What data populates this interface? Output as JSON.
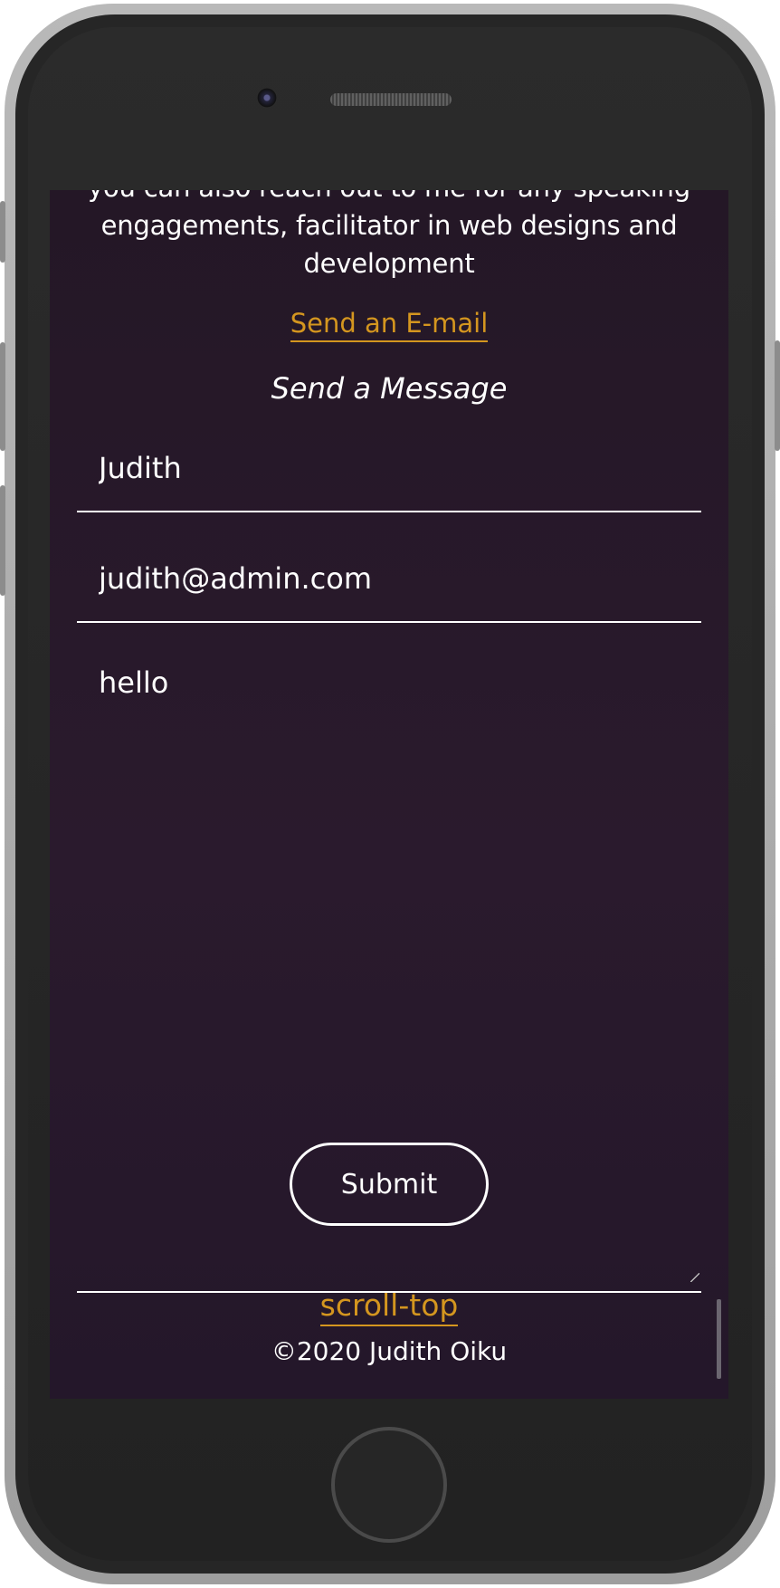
{
  "page": {
    "intro_text_partial": "you can also reach out to me for any speaking",
    "intro_text": "engagements, facilitator in web designs and development",
    "email_link": "Send an E-mail",
    "form_title": "Send a Message"
  },
  "form": {
    "name_value": "Judith",
    "email_value": "judith@admin.com",
    "message_value": "hello",
    "submit_label": "Submit"
  },
  "footer": {
    "scroll_top": "scroll-top",
    "copyright": "©2020 Judith Oiku"
  },
  "colors": {
    "background": "#241726",
    "accent": "#d4961f",
    "text": "#ffffff",
    "phone_body": "#262626"
  },
  "icons": {
    "camera": "camera-icon",
    "speaker": "speaker-grille-icon",
    "home": "home-button-icon"
  }
}
